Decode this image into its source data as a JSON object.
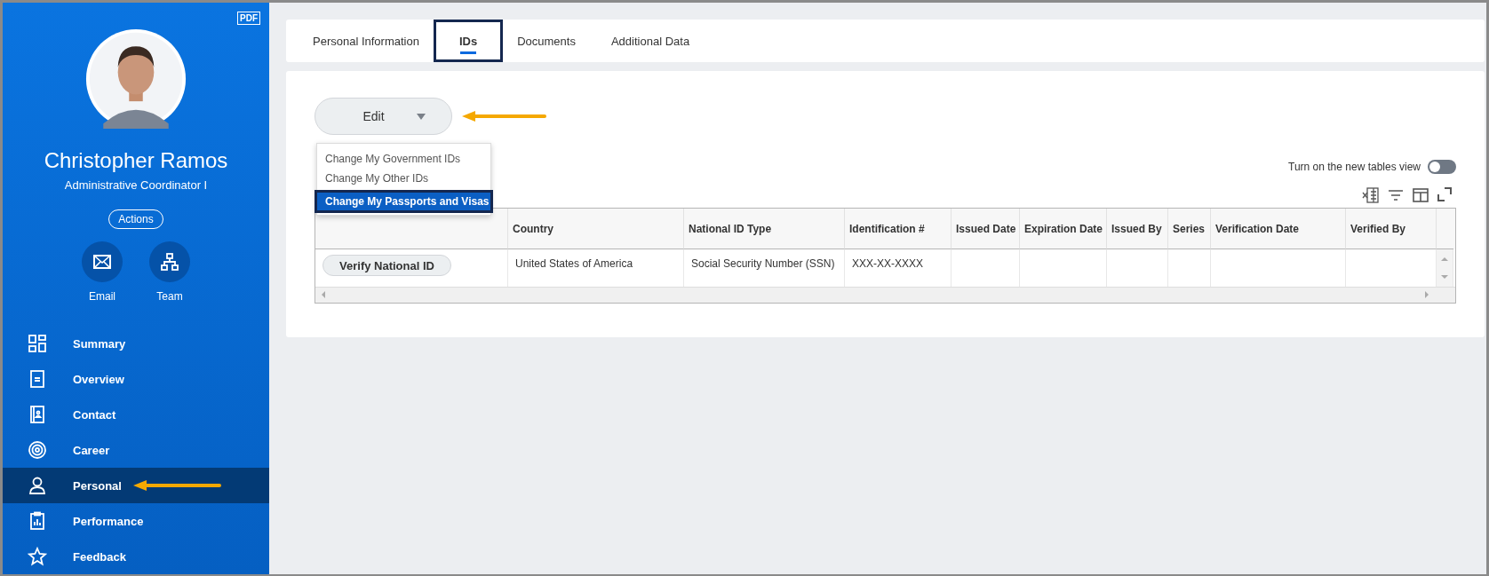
{
  "profile": {
    "name": "Christopher Ramos",
    "title": "Administrative Coordinator I",
    "actions_button": "Actions",
    "pdf_label": "PDF",
    "quick_actions": [
      {
        "label": "Email"
      },
      {
        "label": "Team"
      }
    ]
  },
  "nav": [
    {
      "label": "Summary",
      "selected": false
    },
    {
      "label": "Overview",
      "selected": false
    },
    {
      "label": "Contact",
      "selected": false
    },
    {
      "label": "Career",
      "selected": false
    },
    {
      "label": "Personal",
      "selected": true
    },
    {
      "label": "Performance",
      "selected": false
    },
    {
      "label": "Feedback",
      "selected": false
    }
  ],
  "tabs": [
    {
      "label": "Personal Information",
      "selected": false
    },
    {
      "label": "IDs",
      "selected": true
    },
    {
      "label": "Documents",
      "selected": false
    },
    {
      "label": "Additional Data",
      "selected": false
    }
  ],
  "edit_button": {
    "label": "Edit"
  },
  "menu": [
    {
      "label": "Change My Government IDs",
      "selected": false
    },
    {
      "label": "Change My Other IDs",
      "selected": false
    },
    {
      "label": "Change My Passports and Visas",
      "selected": true
    }
  ],
  "toggle": {
    "label": "Turn on the new tables view",
    "on": false
  },
  "table": {
    "columns": [
      "Country",
      "National ID Type",
      "Identification #",
      "Issued Date",
      "Expiration Date",
      "Issued By",
      "Series",
      "Verification Date",
      "Verified By"
    ],
    "rows": [
      {
        "action": "Verify National ID",
        "cells": [
          "United States of America",
          "Social Security Number (SSN)",
          "XXX-XX-XXXX"
        ]
      }
    ]
  }
}
